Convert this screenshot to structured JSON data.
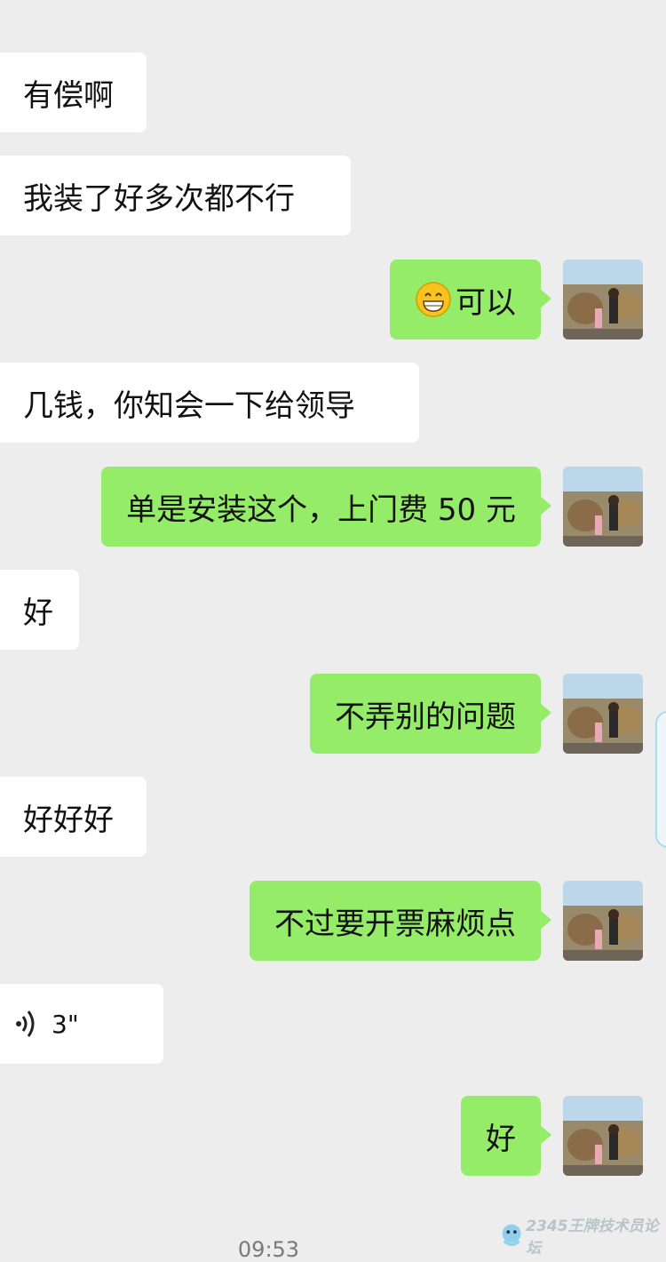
{
  "messages": [
    {
      "side": "in",
      "text": "有偿啊"
    },
    {
      "side": "in",
      "text": "我装了好多次都不行"
    },
    {
      "side": "out",
      "emoji": "grinning-face",
      "text": "可以"
    },
    {
      "side": "in",
      "text": "几钱，你知会一下给领导"
    },
    {
      "side": "out",
      "text": "单是安装这个，上门费 50 元"
    },
    {
      "side": "in",
      "text": "好"
    },
    {
      "side": "out",
      "text": "不弄别的问题"
    },
    {
      "side": "in",
      "text": "好好好"
    },
    {
      "side": "out",
      "text": "不过要开票麻烦点"
    },
    {
      "side": "in",
      "type": "voice",
      "duration": "3\""
    },
    {
      "side": "out",
      "text": "好"
    }
  ],
  "timestamp": "09:53",
  "watermark": {
    "text": "2345王牌技术员论坛"
  },
  "colors": {
    "background": "#ededed",
    "incoming_bubble": "#ffffff",
    "outgoing_bubble": "#95ec69"
  }
}
